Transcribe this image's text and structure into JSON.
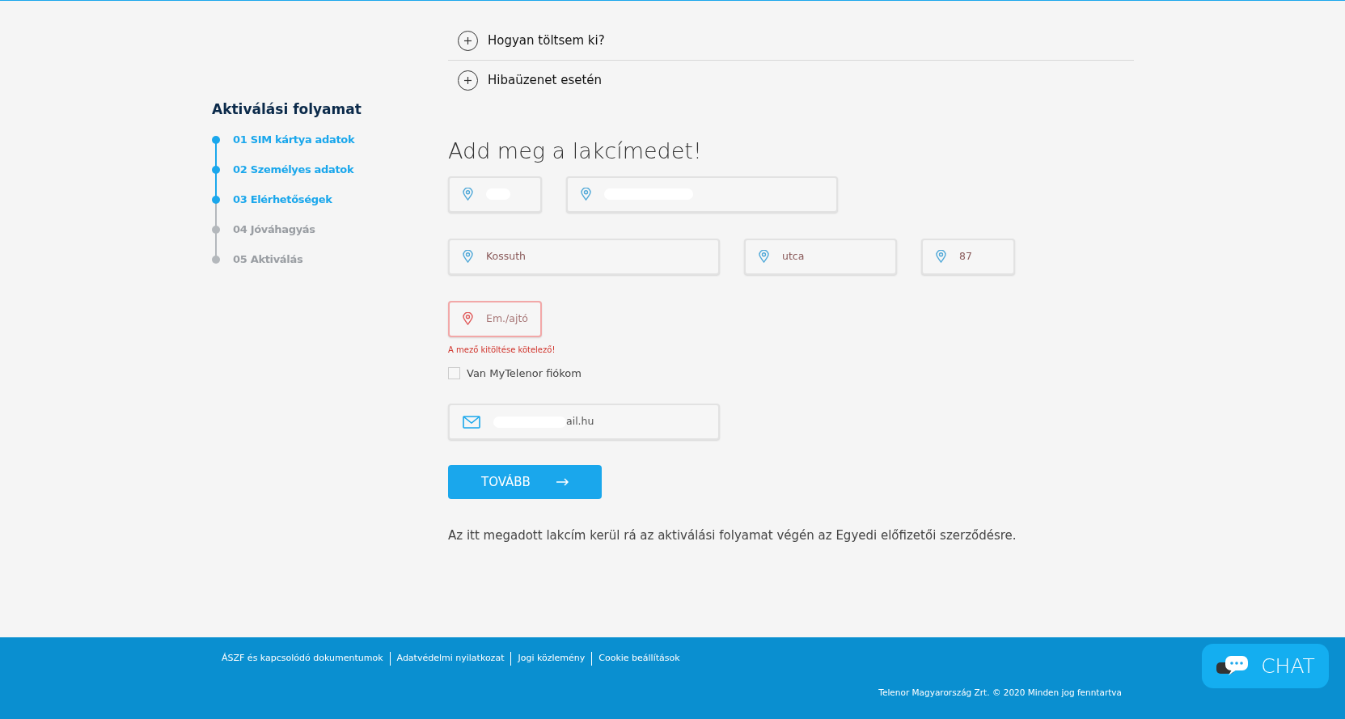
{
  "accordion": [
    {
      "label": "Hogyan töltsem ki?",
      "expanded": false
    },
    {
      "label": "Hibaüzenet esetén",
      "expanded": false
    }
  ],
  "sidebar": {
    "title": "Aktiválási folyamat",
    "steps": [
      {
        "label": "01 SIM kártya adatok",
        "done": true
      },
      {
        "label": "02 Személyes adatok",
        "done": true
      },
      {
        "label": "03 Elérhetőségek",
        "done": true
      },
      {
        "label": "04 Jóváhagyás",
        "done": false
      },
      {
        "label": "05 Aktiválás",
        "done": false
      }
    ]
  },
  "form": {
    "title": "Add meg a lakcímedet!",
    "rows": [
      [
        {
          "kind": "location",
          "redacted": true
        },
        {
          "kind": "location",
          "redacted": true
        }
      ],
      [
        {
          "kind": "location",
          "value": "Kossuth"
        },
        {
          "kind": "location",
          "value": "utca"
        },
        {
          "kind": "location",
          "value": "87"
        }
      ],
      [
        {
          "kind": "location",
          "placeholder": "Em./ajtó",
          "error": "A mező kitöltése kötelező!"
        }
      ]
    ],
    "checkbox": {
      "label": "Van MyTelenor fiókom",
      "checked": false
    },
    "email": {
      "kind": "email",
      "value": "ail.hu",
      "redacted": true
    },
    "button": "TOVÁBB",
    "note": "Az itt megadott lakcím kerül rá az aktiválási folyamat végén az Egyedi előfizetői szerződésre."
  },
  "footer": {
    "links": [
      "ÁSZF és kapcsolódó dokumentumok",
      "Adatvédelmi nyilatkozat",
      "Jogi közlemény",
      "Cookie beállítások"
    ],
    "copyright": "Telenor Magyarország Zrt. © 2020 Minden jog fenntartva"
  },
  "chat": {
    "label": "CHAT"
  }
}
